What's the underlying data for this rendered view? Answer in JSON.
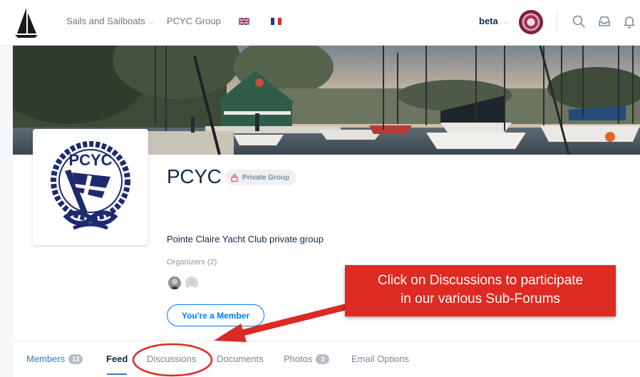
{
  "topnav": {
    "menu": [
      {
        "label": "Sails and Sailboats",
        "has_dropdown": true
      },
      {
        "label": "PCYC Group",
        "has_dropdown": false
      }
    ],
    "user_name": "beta",
    "icons": [
      "search-icon",
      "inbox-icon",
      "bell-icon"
    ]
  },
  "group": {
    "name": "PCYC",
    "badge": "Private Group",
    "description": "Pointe Claire Yacht Club private group",
    "organizers_label": "Organizers (2)",
    "member_button": "You're a Member",
    "logo_text": "PCYC"
  },
  "tabs": [
    {
      "label": "Members",
      "count": "13"
    },
    {
      "label": "Feed"
    },
    {
      "label": "Discussions"
    },
    {
      "label": "Documents"
    },
    {
      "label": "Photos",
      "count": "2"
    },
    {
      "label": "Email Options"
    }
  ],
  "annotation": {
    "line1": "Click on Discussions to participate",
    "line2": "in our various Sub-Forums",
    "color": "#dd2a22"
  },
  "colors": {
    "accent": "#007cff",
    "text": "#122b46",
    "muted": "#7a8694"
  }
}
